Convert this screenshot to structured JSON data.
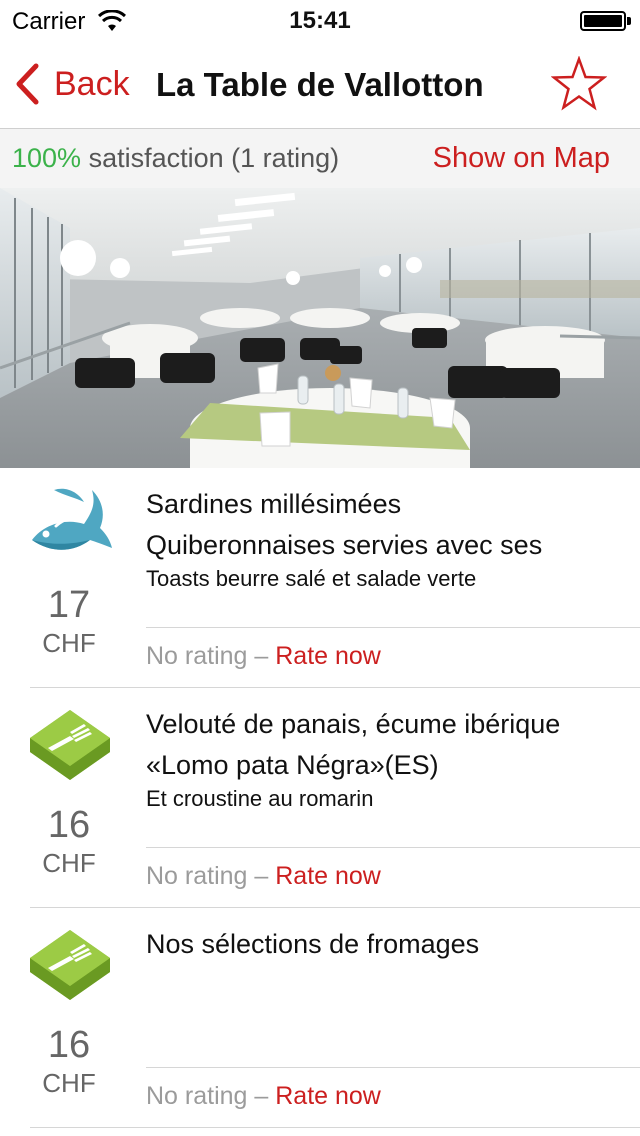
{
  "status_bar": {
    "carrier": "Carrier",
    "time": "15:41",
    "battery_level": 1.0
  },
  "nav": {
    "back_label": "Back",
    "title": "La Table de Vallotton",
    "accent_color": "#cc1f1f"
  },
  "info_bar": {
    "satisfaction_percent": "100%",
    "satisfaction_text": " satisfaction (1 rating)",
    "show_on_map": "Show on Map"
  },
  "menu_items": [
    {
      "icon": "fish-icon",
      "title_line1": "Sardines millésimées",
      "title_line2": "Quiberonnaises servies avec ses",
      "description": "Toasts beurre salé et salade verte",
      "price": "17",
      "currency": "CHF",
      "rating_text": "No rating",
      "rating_separator": " – ",
      "rate_link": "Rate now"
    },
    {
      "icon": "fork-icon",
      "title_line1": "Velouté de panais, écume ibérique",
      "title_line2": "«Lomo pata Négra»(ES)",
      "description": "Et croustine au romarin",
      "price": "16",
      "currency": "CHF",
      "rating_text": "No rating",
      "rating_separator": " – ",
      "rate_link": "Rate now"
    },
    {
      "icon": "fork-icon",
      "title_line1": "Nos sélections de fromages",
      "title_line2": "",
      "description": "",
      "price": "16",
      "currency": "CHF",
      "rating_text": "No rating",
      "rating_separator": " – ",
      "rate_link": "Rate now"
    }
  ]
}
